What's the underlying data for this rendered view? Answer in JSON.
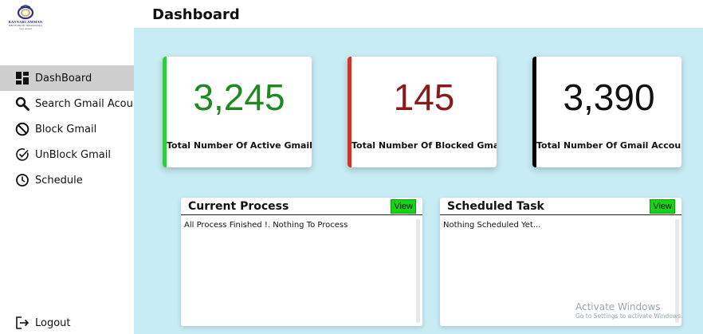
{
  "logo": {
    "line1": "BANNARI AMMAN",
    "line2": "INSTITUTE OF TECHNOLOGY",
    "line3": "Stay Ahead"
  },
  "sidebar": {
    "items": [
      {
        "label": "DashBoard",
        "icon": "dashboard-icon",
        "active": true
      },
      {
        "label": "Search Gmail Acount",
        "icon": "search-icon",
        "active": false
      },
      {
        "label": "Block Gmail",
        "icon": "block-icon",
        "active": false
      },
      {
        "label": "UnBlock Gmail",
        "icon": "check-circle-icon",
        "active": false
      },
      {
        "label": "Schedule",
        "icon": "clock-icon",
        "active": false
      }
    ],
    "logout": "Logout"
  },
  "header": {
    "title": "Dashboard"
  },
  "stats": [
    {
      "value": "3,245",
      "label": "Total Number Of Active Gmail",
      "color": "#1f8a1f",
      "accent": "#2ecc40"
    },
    {
      "value": "145",
      "label": "Total Number Of Blocked Gmail",
      "color": "#8b1a1a",
      "accent": "#d0352b"
    },
    {
      "value": "3,390",
      "label": "Total Number Of Gmail Account",
      "color": "#111111",
      "accent": "#000000"
    }
  ],
  "panels": {
    "current": {
      "title": "Current Process",
      "view": "View",
      "message": "All Process Finished !. Nothing To Process"
    },
    "scheduled": {
      "title": "Scheduled Task",
      "view": "View",
      "message": "Nothing Scheduled Yet..."
    }
  },
  "watermark": {
    "line1": "Activate Windows",
    "line2": "Go to Settings to activate Windows."
  },
  "colors": {
    "main_bg": "#c7ecf4",
    "active_nav": "#cfcfcf",
    "view_button": "#14d414"
  }
}
